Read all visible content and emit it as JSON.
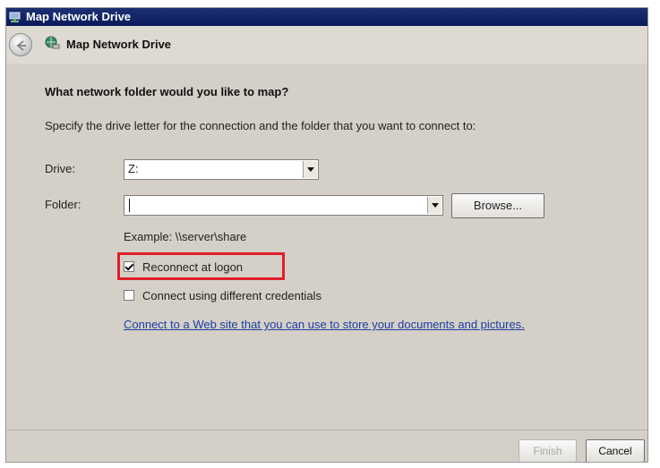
{
  "window": {
    "title": "Map Network Drive"
  },
  "nav": {
    "back_icon": "back-arrow-icon",
    "wizard_icon": "network-drive-icon",
    "title": "Map Network Drive"
  },
  "content": {
    "heading": "What network folder would you like to map?",
    "description": "Specify the drive letter for the connection and the folder that you want to connect to:",
    "drive_label": "Drive:",
    "drive_value": "Z:",
    "folder_label": "Folder:",
    "folder_value": "",
    "browse_label": "Browse...",
    "example": "Example: \\\\server\\share",
    "reconnect_label": "Reconnect at logon",
    "reconnect_checked": true,
    "credentials_label": "Connect using different credentials",
    "credentials_checked": false,
    "web_link": "Connect to a Web site that you can use to store your documents and pictures",
    "web_link_suffix": "."
  },
  "footer": {
    "finish_label": "Finish",
    "finish_enabled": false,
    "cancel_label": "Cancel"
  },
  "colors": {
    "highlight": "#e01d2a",
    "link": "#1d3ea3",
    "titlebar": "#0a1b5c",
    "dialog_bg": "#d4d0c8"
  }
}
